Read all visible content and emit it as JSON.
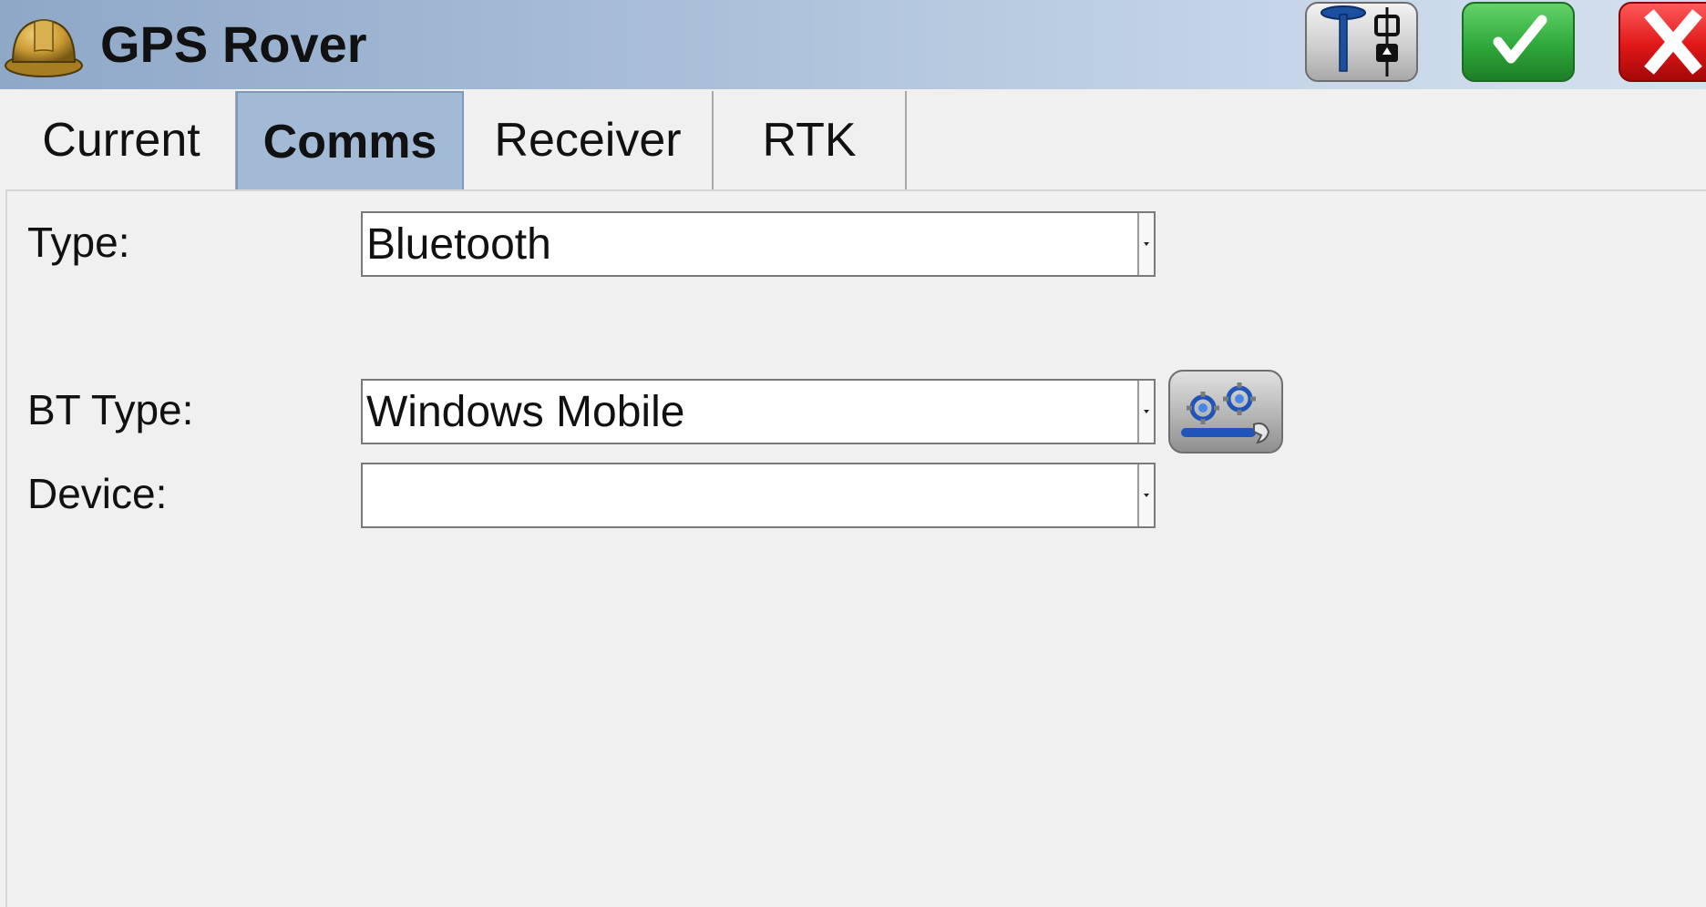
{
  "window": {
    "title": "GPS Rover",
    "app_icon": "hard-hat-icon"
  },
  "toolbar": {
    "receiver_button_icon": "gps-receiver-connect-icon",
    "ok_button_icon": "checkmark-icon",
    "cancel_button_icon": "close-x-icon"
  },
  "tabs": [
    {
      "label": "Current",
      "active": false
    },
    {
      "label": "Comms",
      "active": true
    },
    {
      "label": "Receiver",
      "active": false
    },
    {
      "label": "RTK",
      "active": false
    }
  ],
  "form": {
    "type": {
      "label": "Type:",
      "value": "Bluetooth"
    },
    "bt_type": {
      "label": "BT Type:",
      "value": "Windows Mobile"
    },
    "device": {
      "label": "Device:",
      "value": ""
    },
    "bt_settings_icon": "gears-wrench-icon"
  },
  "colors": {
    "active_tab": "#a3bad6",
    "ok_green": "#2fa83a",
    "cancel_red": "#e01717",
    "background": "#f0f0f0"
  }
}
